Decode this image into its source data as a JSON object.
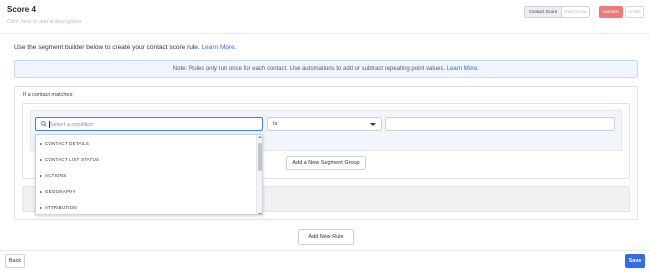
{
  "header": {
    "title": "Score 4",
    "subtitle": "Click here to add a description",
    "score_type_toggle": {
      "contact_label": "Contact Score",
      "deal_label": "Deal Score",
      "selected": "Contact Score"
    },
    "status_toggle": {
      "inactive_label": "Inactive",
      "active_label": "Active",
      "selected": "Inactive"
    }
  },
  "intro": {
    "text": "Use the segment builder below to create your contact score rule.",
    "link": "Learn More."
  },
  "note": {
    "text": "Note: Rules only run once for each contact. Use automations to add or subtract repeating point values.",
    "link": "Learn More."
  },
  "rule": {
    "match_label": "If a contact matches:",
    "condition_search": {
      "placeholder": "Select a condition",
      "value": ""
    },
    "operator": {
      "selected": "Is"
    },
    "value_field": {
      "value": ""
    },
    "dropdown_options": [
      "CONTACT DETAILS",
      "CONTACT LIST STATUS",
      "ACTIONS",
      "GEOGRAPHY",
      "ATTRIBUTION"
    ],
    "add_group_label": "Add a New Segment Group"
  },
  "add_rule_label": "Add New Rule",
  "footer": {
    "back_label": "Back",
    "save_label": "Save"
  },
  "colors": {
    "primary_blue": "#356ae6",
    "inactive_red": "#ec7a79",
    "note_bg": "#eef5fd"
  },
  "icons": {
    "search": "search-icon",
    "operator_caret": "caret-down-icon",
    "option_caret": "caret-right-icon"
  }
}
